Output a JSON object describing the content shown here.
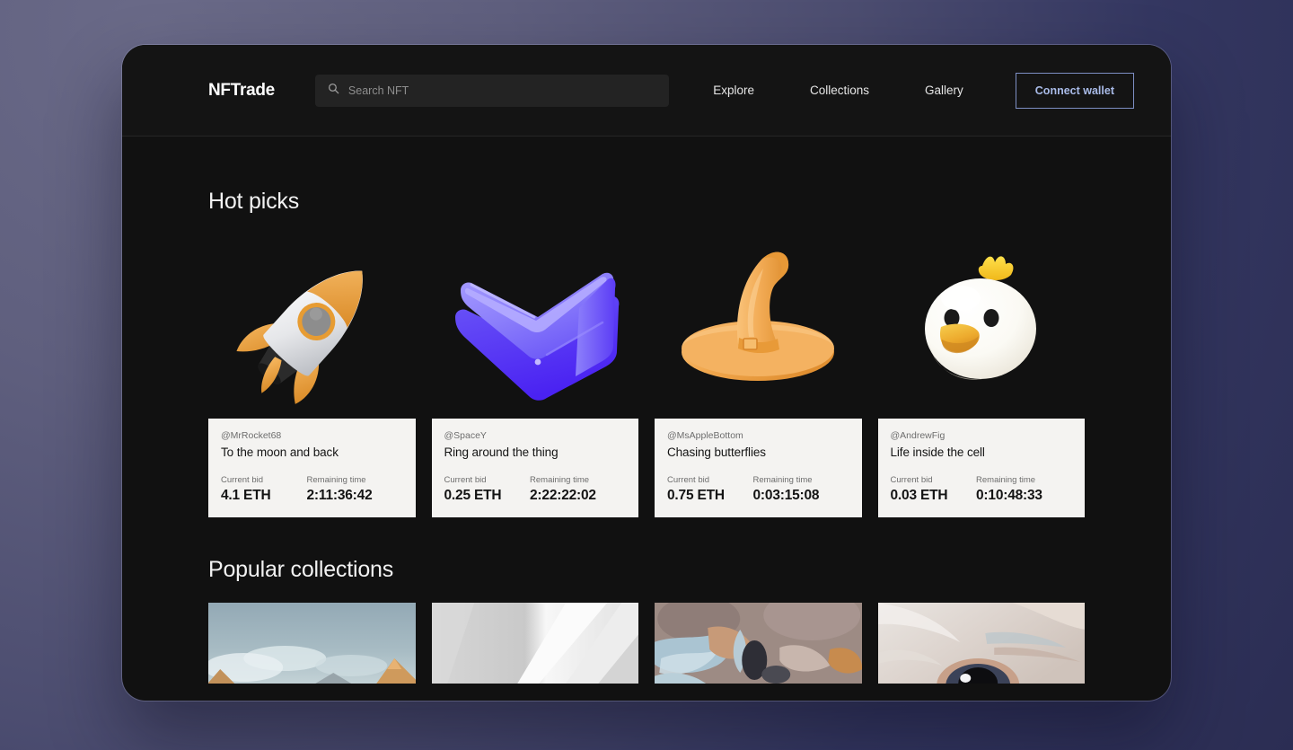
{
  "header": {
    "logo": "NFTrade",
    "search": {
      "placeholder": "Search NFT",
      "value": "",
      "icon": "search-icon"
    },
    "nav_links": [
      "Explore",
      "Collections",
      "Gallery"
    ],
    "connect_wallet_label": "Connect wallet",
    "accent_border_color": "#7d8fc4",
    "accent_text_color": "#a9bbe8"
  },
  "sections": {
    "hot_picks_title": "Hot picks",
    "popular_collections_title": "Popular collections"
  },
  "labels": {
    "current_bid": "Current bid",
    "remaining_time": "Remaining time"
  },
  "hot_picks": [
    {
      "user": "@MrRocket68",
      "title": "To the moon and back",
      "current_bid": "4.1 ETH",
      "remaining_time": "2:11:36:42",
      "art": "rocket-3d",
      "art_colors": {
        "body": "#e9eaec",
        "accent": "#efa542",
        "nozzle": "#2a2a2a",
        "window": "#8b8b8b"
      }
    },
    {
      "user": "@SpaceY",
      "title": "Ring around the thing",
      "current_bid": "0.25 ETH",
      "remaining_time": "2:22:22:02",
      "art": "purple-chevron-3d",
      "art_colors": {
        "light": "#9289ff",
        "mid": "#6f5dfa",
        "deep": "#4722f2"
      }
    },
    {
      "user": "@MsAppleBottom",
      "title": "Chasing butterflies",
      "current_bid": "0.75 ETH",
      "remaining_time": "0:03:15:08",
      "art": "witch-hat-3d",
      "art_colors": {
        "light": "#f6b45e",
        "mid": "#eda044",
        "dark": "#dd8a2c"
      }
    },
    {
      "user": "@AndrewFig",
      "title": "Life inside the cell",
      "current_bid": "0.03 ETH",
      "remaining_time": "0:10:48:33",
      "art": "chick-3d",
      "art_colors": {
        "body": "#fdfdfa",
        "shade": "#efeade",
        "beak": "#f0b233",
        "crest": "#ffd21e",
        "eye": "#1b1b1b"
      }
    }
  ],
  "popular_collections": [
    {
      "art": "mountain-sky-photo",
      "art_colors": {
        "sky": "#9fb3bd",
        "cloud": "#e4ecef",
        "peak": "#d39a5e"
      }
    },
    {
      "art": "white-abstract-photo",
      "art_colors": {
        "light": "#f6f6f6",
        "mid": "#e3e3e3",
        "dark": "#cfcfcf"
      }
    },
    {
      "art": "blue-tan-organic-photo",
      "art_colors": {
        "base": "#9d8b84",
        "blue": "#a9c3d2",
        "tan": "#c8a183",
        "dark": "#3a3a42"
      }
    },
    {
      "art": "eye-closeup-photo",
      "art_colors": {
        "skin": "#ded7d2",
        "highlight": "#f2eeeb",
        "iris": "#3b4258",
        "pupil": "#0d0d10"
      }
    }
  ]
}
